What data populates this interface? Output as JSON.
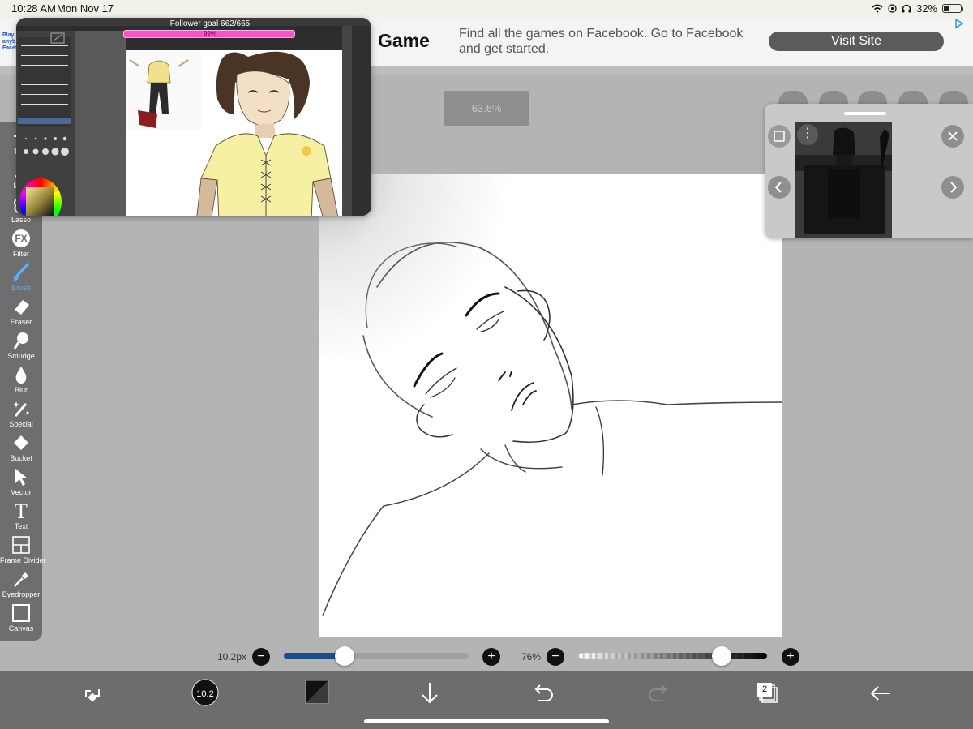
{
  "status": {
    "time": "10:28 AM",
    "date": "Mon Nov 17",
    "battery": "32%",
    "battery_level": 0.32
  },
  "ad": {
    "left_text": "Play anyb Faceb",
    "title": "Game",
    "description": "Find all the games on Facebook. Go to Facebook and get started.",
    "button": "Visit Site"
  },
  "zoom": "63.6%",
  "stream": {
    "goal_label": "Follower goal",
    "goal_count": "662/665",
    "goal_percent": "99%",
    "goal_fraction": 0.99
  },
  "tools": [
    {
      "label": "Tran",
      "icon": "move-icon"
    },
    {
      "label": "Magi",
      "icon": "magic-wand-icon"
    },
    {
      "label": "Lasso",
      "icon": "lasso-icon"
    },
    {
      "label": "Filter",
      "icon": "fx-icon",
      "glyph": "FX"
    },
    {
      "label": "Brush",
      "icon": "brush-icon"
    },
    {
      "label": "Eraser",
      "icon": "eraser-icon"
    },
    {
      "label": "Smudge",
      "icon": "smudge-icon"
    },
    {
      "label": "Blur",
      "icon": "blur-drop-icon"
    },
    {
      "label": "Special",
      "icon": "special-wand-icon"
    },
    {
      "label": "Bucket",
      "icon": "bucket-icon"
    },
    {
      "label": "Vector",
      "icon": "cursor-arrow-icon"
    },
    {
      "label": "Text",
      "icon": "text-icon",
      "glyph": "T"
    },
    {
      "label": "Frame Divider",
      "icon": "frame-divider-icon"
    },
    {
      "label": "Eyedropper",
      "icon": "eyedropper-icon"
    },
    {
      "label": "Canvas",
      "icon": "canvas-icon"
    }
  ],
  "brush": {
    "size_label": "10.2px",
    "size_fraction": 0.33,
    "opacity_label": "76%",
    "opacity_fraction": 0.76,
    "size_badge": "10.2"
  },
  "layers_count": "2",
  "colors": {
    "accent": "#1a4f8a",
    "active_tool": "#5aaeff",
    "goal_pink": "#ff4fc9",
    "toolbar": "#6e6e6e"
  }
}
